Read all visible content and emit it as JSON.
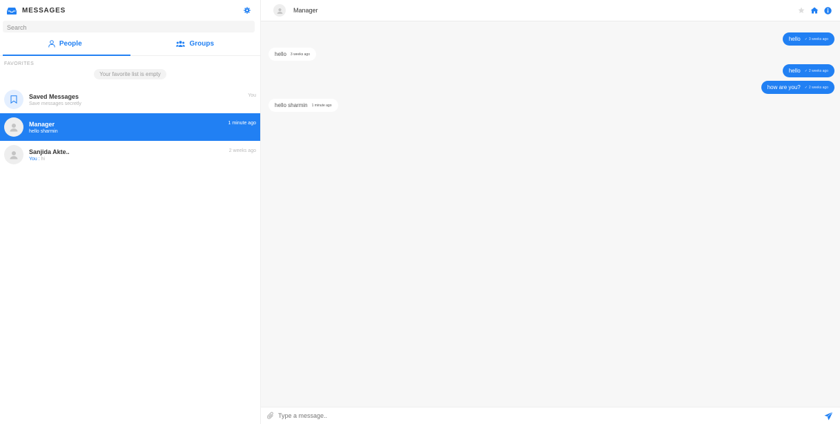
{
  "colors": {
    "accent": "#2180f3",
    "background": "#f7f7f7"
  },
  "sidebar": {
    "title": "MESSAGES",
    "title_icon": "inbox-icon",
    "settings_icon": "gear-icon",
    "search": {
      "placeholder": "Search",
      "value": ""
    },
    "tabs": [
      {
        "label": "People",
        "icon": "user-icon",
        "active": true
      },
      {
        "label": "Groups",
        "icon": "users-icon",
        "active": false
      }
    ],
    "favorites_label": "FAVORITES",
    "favorites_empty": "Your favorite list is empty",
    "contacts": [
      {
        "name": "Saved Messages",
        "subtitle": "Save messages secretly",
        "time": "You",
        "icon": "bookmark-icon",
        "active": false
      },
      {
        "name": "Manager",
        "subtitle": "hello sharmin",
        "time": "1 minute ago",
        "icon": "user-avatar-icon",
        "active": true
      },
      {
        "name": "Sanjida Akte..",
        "subtitle_prefix": "You :",
        "subtitle": "hi",
        "time": "2 weeks ago",
        "icon": "user-avatar-icon",
        "active": false
      }
    ]
  },
  "chat": {
    "header_name": "Manager",
    "header_icons": [
      "star-icon",
      "home-icon",
      "info-icon"
    ],
    "messages": [
      {
        "direction": "out",
        "text": "hello",
        "time": "3 weeks ago"
      },
      {
        "direction": "in",
        "text": "hello",
        "time": "3 weeks ago"
      },
      {
        "direction": "out",
        "text": "hello",
        "time": "2 weeks ago"
      },
      {
        "direction": "out",
        "text": "how are you?",
        "time": "2 weeks ago"
      },
      {
        "direction": "in",
        "text": "hello sharmin",
        "time": "1 minute ago"
      }
    ],
    "composer": {
      "placeholder": "Type a message..",
      "value": "",
      "attach_icon": "paperclip-icon",
      "send_icon": "send-icon"
    }
  }
}
